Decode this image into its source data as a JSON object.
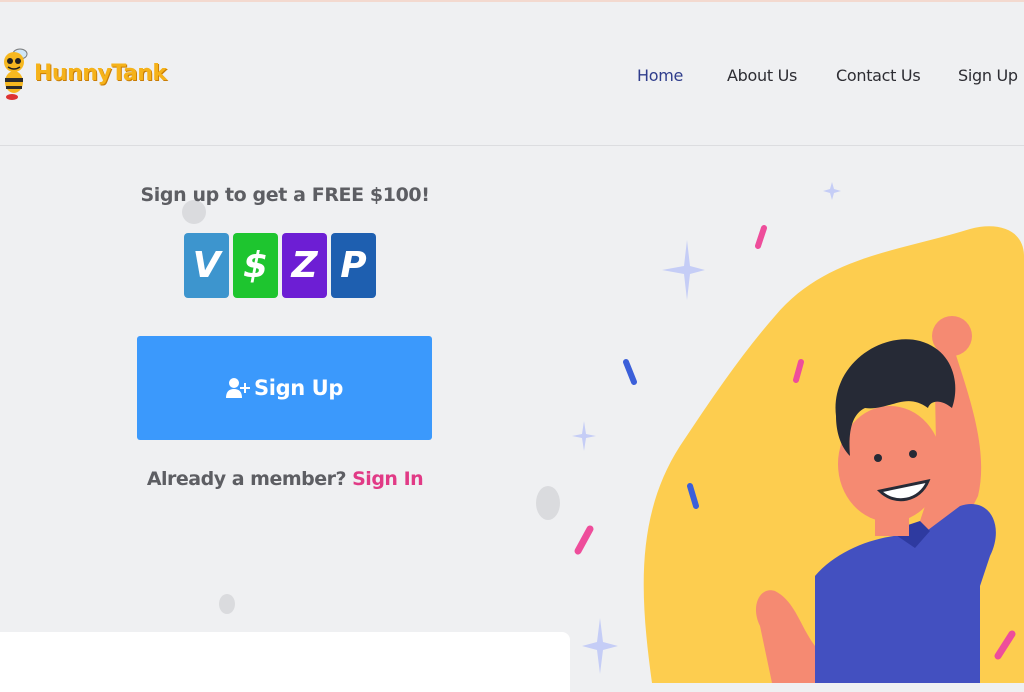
{
  "brand": {
    "name": "HunnyTank"
  },
  "nav": {
    "home": "Home",
    "about": "About Us",
    "contact": "Contact Us",
    "signup": "Sign Up"
  },
  "promo": {
    "title": "Sign up to get a FREE $100!"
  },
  "payments": [
    {
      "icon": "venmo-icon",
      "glyph": "V",
      "color": "#3d95ce"
    },
    {
      "icon": "cashapp-icon",
      "glyph": "$",
      "color": "#1ec52f"
    },
    {
      "icon": "zelle-icon",
      "glyph": "Z",
      "color": "#6d1ed4"
    },
    {
      "icon": "paypal-icon",
      "glyph": "P",
      "color": "#1e5fb0"
    }
  ],
  "cta": {
    "label": "Sign Up"
  },
  "member": {
    "prompt": "Already a member? ",
    "link": "Sign In"
  },
  "colors": {
    "accent": "#3b99fc",
    "nav_active": "#2f3d8c",
    "link": "#e13a86",
    "brand": "#f5b21a",
    "blob": "#fdcd4f"
  }
}
